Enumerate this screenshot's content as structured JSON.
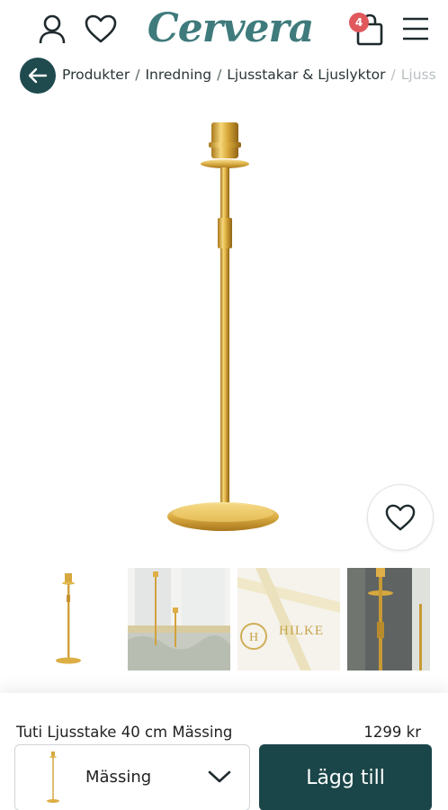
{
  "header": {
    "logo_text": "Cervera",
    "cart_count": "4",
    "icons": [
      "account-icon",
      "heart-icon",
      "shopping-bag-icon",
      "hamburger-menu-icon"
    ]
  },
  "breadcrumb": {
    "items": [
      "Produkter",
      "Inredning",
      "Ljusstakar & Ljuslyktor",
      "Ljuss"
    ],
    "separator": "/"
  },
  "product": {
    "name": "Tuti Ljusstake 40 cm Mässing",
    "price": "1299 kr"
  },
  "thumbnails": {
    "logo_text": "HILKE"
  },
  "purchase": {
    "variant_selected": "Mässing",
    "add_to_cart_label": "Lägg till"
  },
  "colors": {
    "brand": "#3f7a7c",
    "primary_button": "#1b4649",
    "badge": "#e0585c",
    "brass": "#d9b24a"
  }
}
